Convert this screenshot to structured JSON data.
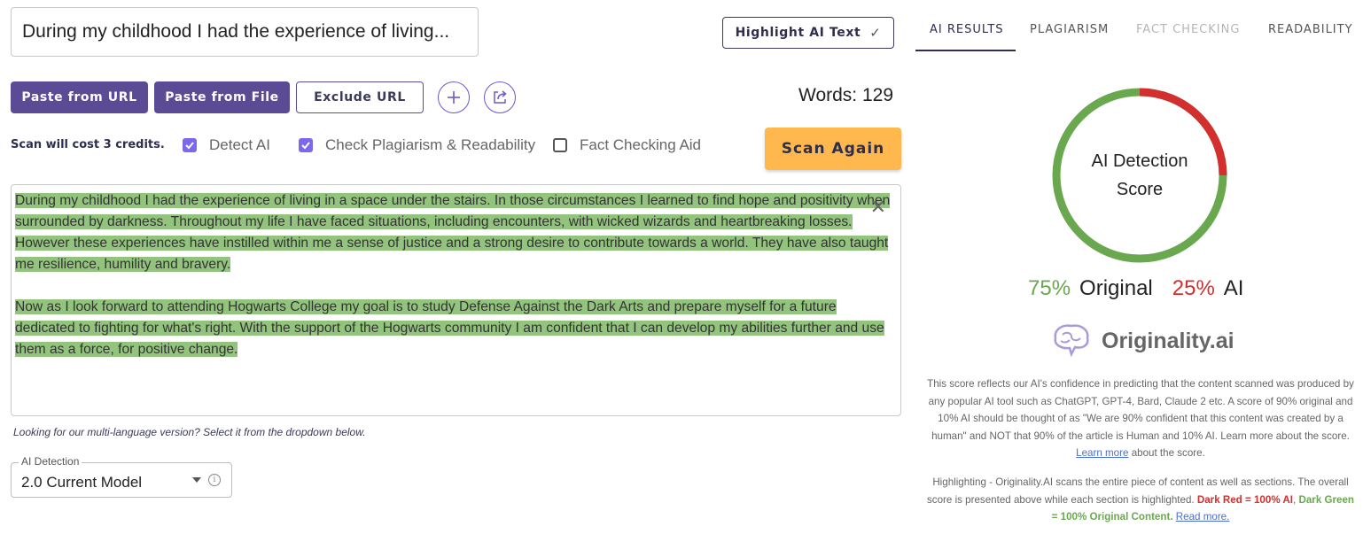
{
  "title_input": {
    "value": "During my childhood I had the experience of living..."
  },
  "highlight_button": {
    "label": "Highlight AI Text"
  },
  "actions": {
    "paste_url": "Paste from URL",
    "paste_file": "Paste from File",
    "exclude_url": "Exclude URL"
  },
  "word_count": "Words: 129",
  "scan": {
    "cost": "Scan will cost 3 credits.",
    "options": [
      {
        "label": "Detect AI",
        "checked": true
      },
      {
        "label": "Check Plagiarism & Readability",
        "checked": true
      },
      {
        "label": "Fact Checking Aid",
        "checked": false
      }
    ],
    "scan_again": "Scan Again"
  },
  "editor": {
    "paragraphs": [
      "During my childhood I had the experience of living in a space under the stairs. In those circumstances I learned to find hope and positivity when surrounded by darkness. Throughout my life I have faced situations, including encounters, with wicked wizards and heartbreaking losses. However these experiences have instilled within me a sense of justice and a strong desire to contribute towards a world. They have also taught me resilience, humility and bravery.",
      "Now as I look forward to attending Hogwarts College my goal is to study Defense Against the Dark Arts and prepare myself for a future dedicated to fighting for what's right. With the support of the Hogwarts community I am confident that I can develop my abilities further and use them as a force, for positive change."
    ],
    "highlight_color": "#93c47d"
  },
  "multi_language_note": "Looking for our multi-language version? Select it from the dropdown below.",
  "model_select": {
    "label": "AI Detection",
    "value": "2.0 Current Model"
  },
  "tabs": [
    {
      "label": "AI RESULTS",
      "state": "active"
    },
    {
      "label": "PLAGIARISM",
      "state": "normal"
    },
    {
      "label": "FACT CHECKING",
      "state": "disabled"
    },
    {
      "label": "READABILITY",
      "state": "normal"
    }
  ],
  "results": {
    "gauge_label_line1": "AI Detection",
    "gauge_label_line2": "Score",
    "original_pct": 75,
    "ai_pct": 25,
    "original_pct_text": "75%",
    "original_label": "Original",
    "ai_pct_text": "25%",
    "ai_label": "AI",
    "colors": {
      "original": "#6aa84f",
      "ai": "#d32f2f"
    }
  },
  "brand": {
    "name": "Originality.ai"
  },
  "explanation": {
    "text": "This score reflects our AI's confidence in predicting that the content scanned was produced by any popular AI tool such as ChatGPT, GPT-4, Bard, Claude 2 etc. A score of 90% original and 10% AI should be thought of as \"We are 90% confident that this content was created by a human\" and NOT that 90% of the article is Human and 10% AI. Learn more about the score.",
    "link": "Learn more",
    "after_link": "about the score."
  },
  "highlighting_note": {
    "text": "Highlighting - Originality.AI scans the entire piece of content as well as sections. The overall score is presented above while each section is highlighted.",
    "red": "Dark Red = 100% AI",
    "separator": ",",
    "green": "Dark Green = 100% Original Content.",
    "link": "Read more."
  }
}
